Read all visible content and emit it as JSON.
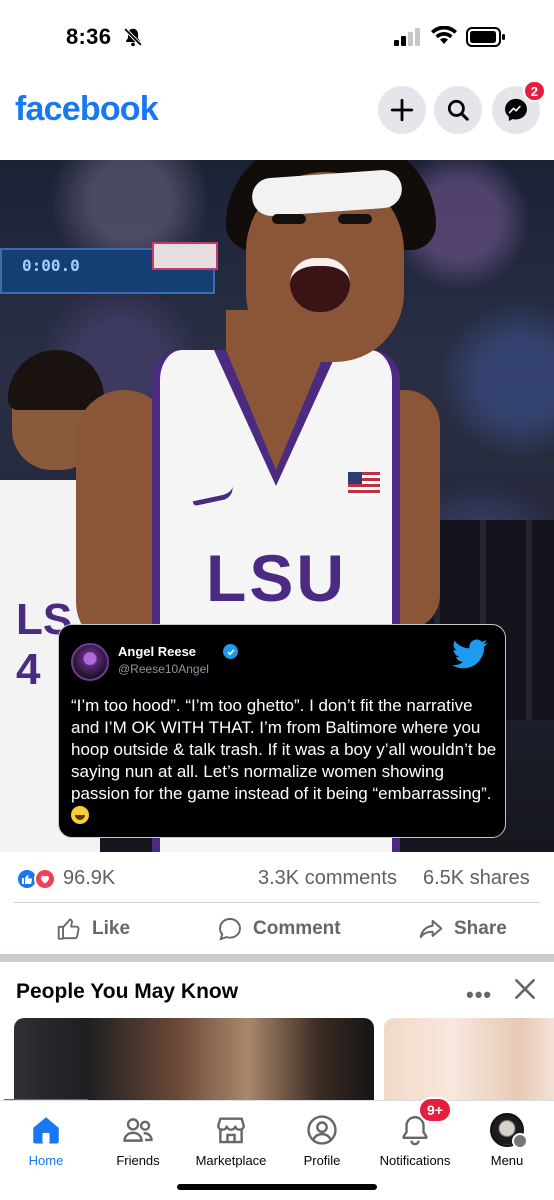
{
  "status_bar": {
    "time": "8:36"
  },
  "header": {
    "logo": "facebook",
    "messenger_badge": "2"
  },
  "post": {
    "tweet": {
      "name": "Angel Reese",
      "handle": "@Reese10Angel",
      "text": "“I’m too hood”. “I’m too ghetto”. I don’t fit the narrative and I’M OK WITH THAT. I’m from Baltimore where you hoop outside & talk trash. If it was a boy y’all wouldn’t be saying nun at all. Let’s normalize women showing passion for the game instead of it being “embarrassing”."
    },
    "jersey_text": "LSU",
    "jersey_text_2": "LS",
    "jersey_number_2": "4",
    "scoreboard_text": "0:00.0",
    "reaction_count": "96.9K",
    "comments": "3.3K comments",
    "shares": "6.5K shares",
    "actions": {
      "like": "Like",
      "comment": "Comment",
      "share": "Share"
    }
  },
  "pymk": {
    "title": "People You May Know",
    "more": "•••"
  },
  "bottom_nav": {
    "items": [
      {
        "label": "Home"
      },
      {
        "label": "Friends"
      },
      {
        "label": "Marketplace"
      },
      {
        "label": "Profile"
      },
      {
        "label": "Notifications"
      },
      {
        "label": "Menu"
      }
    ],
    "notifications_badge": "9+"
  },
  "colors": {
    "brand": "#1877f2",
    "badge": "#e41e3f",
    "lsu_purple": "#4b2a82",
    "twitter_blue": "#1d9bf0"
  }
}
